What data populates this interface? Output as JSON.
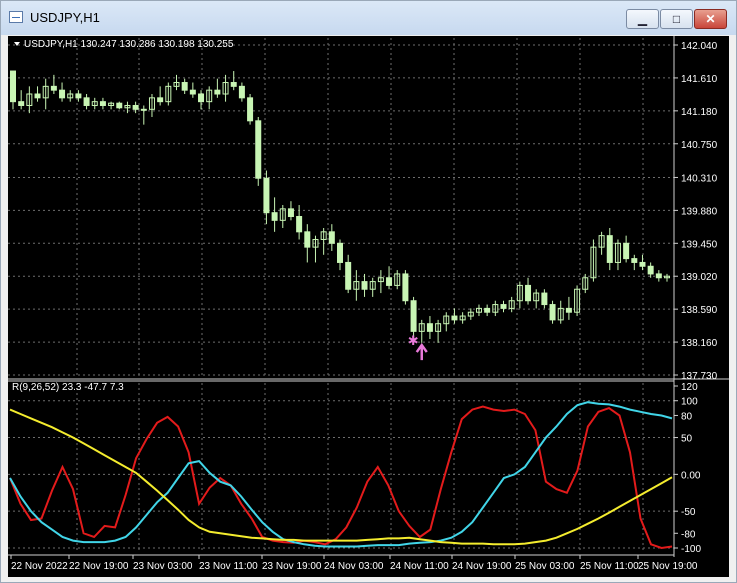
{
  "window": {
    "title": "USDJPY,H1",
    "minimize_glyph": "▁",
    "maximize_glyph": "□",
    "close_glyph": "✕"
  },
  "colors": {
    "background": "#000000",
    "grid": "#6e6e6e",
    "candle": "#c8f5b4",
    "oscillator_red": "#e31b1b",
    "oscillator_cyan": "#41d5e8",
    "oscillator_yellow": "#f4ec2e",
    "signal_marker": "#e879d9"
  },
  "price_header": "USDJPY,H1  130.247 130.286 130.198 130.255",
  "indicator_header": "R(9,26,52) 23.3 -47.7 7.3",
  "chart_data": [
    {
      "type": "candlestick",
      "symbol": "USDJPY",
      "timeframe": "H1",
      "ylim": [
        137.73,
        142.04
      ],
      "y_ticks": [
        "142.040",
        "141.610",
        "141.180",
        "140.750",
        "140.310",
        "139.880",
        "139.450",
        "139.020",
        "138.590",
        "138.160",
        "137.730"
      ],
      "candles": [
        [
          141.7,
          141.2,
          141.6,
          141.3
        ],
        [
          141.3,
          141.2,
          141.45,
          141.25
        ],
        [
          141.25,
          141.15,
          141.5,
          141.4
        ],
        [
          141.4,
          141.3,
          141.5,
          141.35
        ],
        [
          141.35,
          141.2,
          141.6,
          141.5
        ],
        [
          141.5,
          141.4,
          141.65,
          141.45
        ],
        [
          141.45,
          141.3,
          141.55,
          141.35
        ],
        [
          141.35,
          141.3,
          141.45,
          141.4
        ],
        [
          141.4,
          141.3,
          141.45,
          141.35
        ],
        [
          141.35,
          141.2,
          141.4,
          141.25
        ],
        [
          141.25,
          141.2,
          141.35,
          141.3
        ],
        [
          141.3,
          141.2,
          141.35,
          141.25
        ],
        [
          141.25,
          141.2,
          141.3,
          141.28
        ],
        [
          141.28,
          141.2,
          141.3,
          141.22
        ],
        [
          141.22,
          141.15,
          141.3,
          141.25
        ],
        [
          141.25,
          141.15,
          141.3,
          141.2
        ],
        [
          141.2,
          141.0,
          141.25,
          141.2
        ],
        [
          141.2,
          141.1,
          141.4,
          141.35
        ],
        [
          141.35,
          141.25,
          141.5,
          141.3
        ],
        [
          141.3,
          141.25,
          141.55,
          141.5
        ],
        [
          141.5,
          141.45,
          141.65,
          141.55
        ],
        [
          141.55,
          141.4,
          141.6,
          141.45
        ],
        [
          141.45,
          141.35,
          141.55,
          141.4
        ],
        [
          141.4,
          141.2,
          141.45,
          141.3
        ],
        [
          141.3,
          141.2,
          141.5,
          141.45
        ],
        [
          141.45,
          141.35,
          141.6,
          141.4
        ],
        [
          141.4,
          141.3,
          141.65,
          141.55
        ],
        [
          141.55,
          141.45,
          141.7,
          141.5
        ],
        [
          141.5,
          141.3,
          141.55,
          141.35
        ],
        [
          141.35,
          141.0,
          141.4,
          141.05
        ],
        [
          141.05,
          140.2,
          141.1,
          140.3
        ],
        [
          140.3,
          139.7,
          140.4,
          139.85
        ],
        [
          139.85,
          139.6,
          140.05,
          139.75
        ],
        [
          139.75,
          139.65,
          139.95,
          139.9
        ],
        [
          139.9,
          139.75,
          140.0,
          139.8
        ],
        [
          139.8,
          139.5,
          139.95,
          139.6
        ],
        [
          139.6,
          139.2,
          139.7,
          139.4
        ],
        [
          139.4,
          139.2,
          139.55,
          139.5
        ],
        [
          139.5,
          139.3,
          139.65,
          139.6
        ],
        [
          139.6,
          139.35,
          139.7,
          139.45
        ],
        [
          139.45,
          139.1,
          139.5,
          139.2
        ],
        [
          139.2,
          138.8,
          139.3,
          138.85
        ],
        [
          138.85,
          138.7,
          139.1,
          138.95
        ],
        [
          138.95,
          138.75,
          139.05,
          138.85
        ],
        [
          138.85,
          138.75,
          139.0,
          138.95
        ],
        [
          138.95,
          138.8,
          139.1,
          139.0
        ],
        [
          139.0,
          138.85,
          139.15,
          138.9
        ],
        [
          138.9,
          138.85,
          139.1,
          139.05
        ],
        [
          139.05,
          138.65,
          139.1,
          138.7
        ],
        [
          138.7,
          138.2,
          138.75,
          138.3
        ],
        [
          138.3,
          138.15,
          138.45,
          138.4
        ],
        [
          138.4,
          138.2,
          138.5,
          138.3
        ],
        [
          138.3,
          138.15,
          138.45,
          138.4
        ],
        [
          138.4,
          138.3,
          138.55,
          138.5
        ],
        [
          138.5,
          138.4,
          138.6,
          138.45
        ],
        [
          138.45,
          138.4,
          138.55,
          138.5
        ],
        [
          138.5,
          138.45,
          138.6,
          138.55
        ],
        [
          138.55,
          138.5,
          138.65,
          138.6
        ],
        [
          138.6,
          138.5,
          138.65,
          138.55
        ],
        [
          138.55,
          138.5,
          138.7,
          138.65
        ],
        [
          138.65,
          138.55,
          138.7,
          138.6
        ],
        [
          138.6,
          138.55,
          138.75,
          138.7
        ],
        [
          138.7,
          138.6,
          138.95,
          138.9
        ],
        [
          138.9,
          138.65,
          139.0,
          138.7
        ],
        [
          138.7,
          138.6,
          138.85,
          138.8
        ],
        [
          138.8,
          138.6,
          138.85,
          138.65
        ],
        [
          138.65,
          138.4,
          138.7,
          138.45
        ],
        [
          138.45,
          138.4,
          138.7,
          138.6
        ],
        [
          138.6,
          138.45,
          138.75,
          138.55
        ],
        [
          138.55,
          138.5,
          138.9,
          138.85
        ],
        [
          138.85,
          138.8,
          139.05,
          139.0
        ],
        [
          139.0,
          138.95,
          139.5,
          139.4
        ],
        [
          139.4,
          139.3,
          139.6,
          139.55
        ],
        [
          139.55,
          139.1,
          139.65,
          139.2
        ],
        [
          139.2,
          139.1,
          139.5,
          139.45
        ],
        [
          139.45,
          139.2,
          139.55,
          139.25
        ],
        [
          139.25,
          139.1,
          139.3,
          139.2
        ],
        [
          139.2,
          139.1,
          139.3,
          139.15
        ],
        [
          139.15,
          139.0,
          139.2,
          139.05
        ],
        [
          139.05,
          138.95,
          139.1,
          139.0
        ],
        [
          139.0,
          138.95,
          139.05,
          139.02
        ]
      ],
      "signal_low": 138.16
    },
    {
      "type": "line",
      "ylim": [
        -100,
        120
      ],
      "y_ticks": [
        "120",
        "100",
        "80",
        "50",
        "0.00",
        "-50",
        "-80",
        "-100"
      ],
      "x_ticks": [
        "22 Nov 2022",
        "22 Nov 19:00",
        "23 Nov 03:00",
        "23 Nov 11:00",
        "23 Nov 19:00",
        "24 Nov 03:00",
        "24 Nov 11:00",
        "24 Nov 19:00",
        "25 Nov 03:00",
        "25 Nov 11:00",
        "25 Nov 19:00"
      ],
      "series": [
        {
          "color": "#e31b1b",
          "values": [
            -5,
            -40,
            -62,
            -60,
            -22,
            10,
            -20,
            -80,
            -85,
            -70,
            -72,
            -28,
            22,
            48,
            70,
            78,
            65,
            30,
            -40,
            -18,
            -5,
            -15,
            -40,
            -60,
            -85,
            -90,
            -92,
            -93,
            -90,
            -92,
            -95,
            -88,
            -72,
            -45,
            -10,
            10,
            -15,
            -50,
            -70,
            -85,
            -75,
            -20,
            30,
            75,
            88,
            92,
            88,
            86,
            88,
            82,
            60,
            -10,
            -20,
            -25,
            5,
            65,
            85,
            90,
            80,
            30,
            -60,
            -95,
            -100,
            -98
          ]
        },
        {
          "color": "#41d5e8",
          "values": [
            -5,
            -30,
            -50,
            -65,
            -75,
            -85,
            -90,
            -92,
            -92,
            -92,
            -90,
            -85,
            -72,
            -55,
            -38,
            -25,
            -5,
            15,
            18,
            2,
            -10,
            -15,
            -30,
            -48,
            -65,
            -78,
            -88,
            -92,
            -95,
            -97,
            -98,
            -98,
            -98,
            -98,
            -97,
            -96,
            -96,
            -96,
            -94,
            -93,
            -92,
            -90,
            -86,
            -78,
            -65,
            -45,
            -25,
            -5,
            0,
            10,
            30,
            50,
            65,
            82,
            94,
            98,
            96,
            95,
            92,
            88,
            85,
            82,
            80,
            76
          ]
        },
        {
          "color": "#f4ec2e",
          "values": [
            88,
            82,
            76,
            70,
            64,
            57,
            50,
            42,
            34,
            26,
            18,
            10,
            2,
            -10,
            -22,
            -35,
            -48,
            -62,
            -72,
            -78,
            -80,
            -82,
            -84,
            -86,
            -87,
            -88,
            -89,
            -89,
            -90,
            -90,
            -90,
            -90,
            -90,
            -90,
            -89,
            -88,
            -87,
            -87,
            -86,
            -88,
            -90,
            -92,
            -93,
            -94,
            -94,
            -94,
            -95,
            -95,
            -95,
            -94,
            -92,
            -90,
            -86,
            -80,
            -74,
            -67,
            -60,
            -52,
            -44,
            -36,
            -28,
            -20,
            -12,
            -4
          ]
        }
      ]
    }
  ]
}
